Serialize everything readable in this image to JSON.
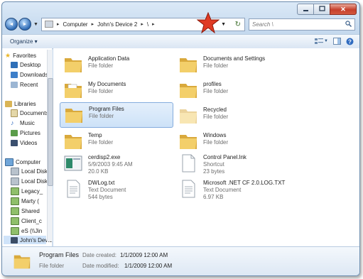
{
  "window": {
    "buttons": {
      "minimize": "▭",
      "maximize": "▭",
      "close": "✕"
    }
  },
  "navigation": {
    "back_glyph": "◄",
    "forward_glyph": "►",
    "breadcrumb": [
      "Computer",
      "John's Device 2",
      "\\"
    ],
    "search_placeholder": "Search \\"
  },
  "toolbar": {
    "organize_label": "Organize ▾"
  },
  "sidebar": {
    "groups": [
      {
        "label": "Favorites",
        "icon": "star-icon",
        "items": [
          {
            "label": "Desktop",
            "icon": "desktop-icon"
          },
          {
            "label": "Downloads",
            "icon": "downloads-icon"
          },
          {
            "label": "Recent",
            "icon": "recent-icon"
          }
        ]
      },
      {
        "label": "Libraries",
        "icon": "libraries-icon",
        "items": [
          {
            "label": "Documents",
            "icon": "documents-icon"
          },
          {
            "label": "Music",
            "icon": "music-icon"
          },
          {
            "label": "Pictures",
            "icon": "pictures-icon"
          },
          {
            "label": "Videos",
            "icon": "videos-icon"
          }
        ]
      },
      {
        "label": "Computer",
        "icon": "computer-icon",
        "items": [
          {
            "label": "Local Disk",
            "icon": "drive-icon"
          },
          {
            "label": "Local Disk",
            "icon": "drive-icon"
          },
          {
            "label": "Legacy_",
            "icon": "network-drive-icon"
          },
          {
            "label": "Marty (",
            "icon": "network-drive-icon"
          },
          {
            "label": "Shared",
            "icon": "network-drive-icon"
          },
          {
            "label": "Client_c",
            "icon": "network-drive-icon"
          },
          {
            "label": "eS (\\\\Jin",
            "icon": "network-drive-icon"
          },
          {
            "label": "John's Device 2",
            "icon": "device-icon"
          }
        ]
      }
    ]
  },
  "files": [
    {
      "name": "Application Data",
      "line2": "File folder",
      "line3": "",
      "icon": "folder-icon"
    },
    {
      "name": "Documents and Settings",
      "line2": "File folder",
      "line3": "",
      "icon": "folder-icon"
    },
    {
      "name": "My Documents",
      "line2": "File folder",
      "line3": "",
      "icon": "folder-documents-icon"
    },
    {
      "name": "profiles",
      "line2": "File folder",
      "line3": "",
      "icon": "folder-icon"
    },
    {
      "name": "Program Files",
      "line2": "File folder",
      "line3": "",
      "icon": "folder-icon"
    },
    {
      "name": "Recycled",
      "line2": "File folder",
      "line3": "",
      "icon": "folder-hidden-icon"
    },
    {
      "name": "Temp",
      "line2": "File folder",
      "line3": "",
      "icon": "folder-icon"
    },
    {
      "name": "Windows",
      "line2": "File folder",
      "line3": "",
      "icon": "folder-icon"
    },
    {
      "name": "cerdisp2.exe",
      "line2": "5/9/2003 9:45 AM",
      "line3": "20.0 KB",
      "icon": "exe-icon"
    },
    {
      "name": "Control Panel.lnk",
      "line2": "Shortcut",
      "line3": "23 bytes",
      "icon": "shortcut-icon"
    },
    {
      "name": "DWLog.txt",
      "line2": "Text Document",
      "line3": "544 bytes",
      "icon": "text-document-icon"
    },
    {
      "name": "Microsoft .NET CF 2.0.LOG.TXT",
      "line2": "Text Document",
      "line3": "6.97 KB",
      "icon": "text-document-icon"
    }
  ],
  "details": {
    "name": "Program Files",
    "type": "File folder",
    "created_label": "Date created:",
    "created_value": "1/1/2009 12:00 AM",
    "modified_label": "Date modified:",
    "modified_value": "1/1/2009 12:00 AM"
  },
  "colors": {
    "folder": "#e8c15a",
    "selection": "#cde2f8",
    "star": "#e03b24"
  }
}
